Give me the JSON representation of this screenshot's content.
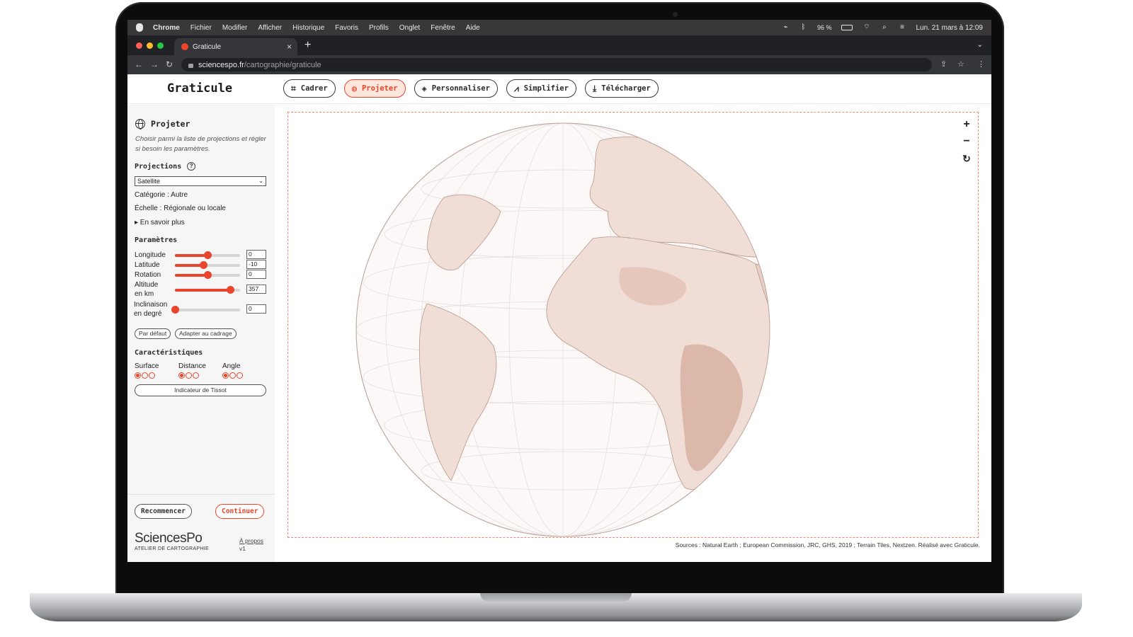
{
  "menubar": {
    "items": [
      "Chrome",
      "Fichier",
      "Modifier",
      "Afficher",
      "Historique",
      "Favoris",
      "Profils",
      "Onglet",
      "Fenêtre",
      "Aide"
    ],
    "battery": "96 %",
    "datetime": "Lun. 21 mars à  12:09"
  },
  "browser": {
    "tab_title": "Graticule",
    "url_host": "sciencespo.fr",
    "url_path": "/cartographie/graticule"
  },
  "app": {
    "title": "Graticule",
    "steps": [
      {
        "label": "Cadrer",
        "icon": "crop-icon",
        "active": false
      },
      {
        "label": "Projeter",
        "icon": "globe-icon",
        "active": true
      },
      {
        "label": "Personnaliser",
        "icon": "layers-icon",
        "active": false
      },
      {
        "label": "Simplifier",
        "icon": "line-chart-icon",
        "active": false
      },
      {
        "label": "Télécharger",
        "icon": "download-icon",
        "active": false
      }
    ]
  },
  "sidebar": {
    "title": "Projeter",
    "description": "Choisir parmi la liste de projections et régler si besoin les paramètres.",
    "projections_label": "Projections",
    "projection_selected": "Satellite",
    "category": "Catégorie : Autre",
    "scale": "Échelle : Régionale ou locale",
    "learn_more": "▸ En savoir plus",
    "params_label": "Paramètres",
    "params": [
      {
        "label_1": "Longitude",
        "label_2": "",
        "value": "0",
        "level": 0.5
      },
      {
        "label_1": "Latitude",
        "label_2": "",
        "value": "-10",
        "level": 0.44
      },
      {
        "label_1": "Rotation",
        "label_2": "",
        "value": "0",
        "level": 0.5
      },
      {
        "label_1": "Altitude",
        "label_2": "en km",
        "value": "357",
        "level": 0.85
      },
      {
        "label_1": "Inclinaison",
        "label_2": "en degré",
        "value": "0",
        "level": 0.0
      }
    ],
    "default_btn": "Par défaut",
    "fit_btn": "Adapter au cadrage",
    "characteristics_label": "Caractéristiques",
    "characteristics": [
      {
        "label": "Surface",
        "rating": 1
      },
      {
        "label": "Distance",
        "rating": 1
      },
      {
        "label": "Angle",
        "rating": 1
      }
    ],
    "tissot_btn": "Indicateur de Tissot",
    "restart_btn": "Recommencer",
    "continue_btn": "Continuer",
    "brand_name": "SciencesPo",
    "brand_sub": "ATELIER DE CARTOGRAPHIE",
    "about_link": "À propos",
    "version": "v1"
  },
  "map": {
    "zoom_in": "+",
    "zoom_out": "−",
    "reset": "↻",
    "sources": "Sources : Natural Earth ; European Commission, JRC, GHS, 2019 ; Terrain Tiles, Nextzen. Réalisé avec Graticule.",
    "land_color": "#f0ddd6",
    "land_dark_color": "#dcb8aa",
    "accent_color": "#e8452c"
  }
}
